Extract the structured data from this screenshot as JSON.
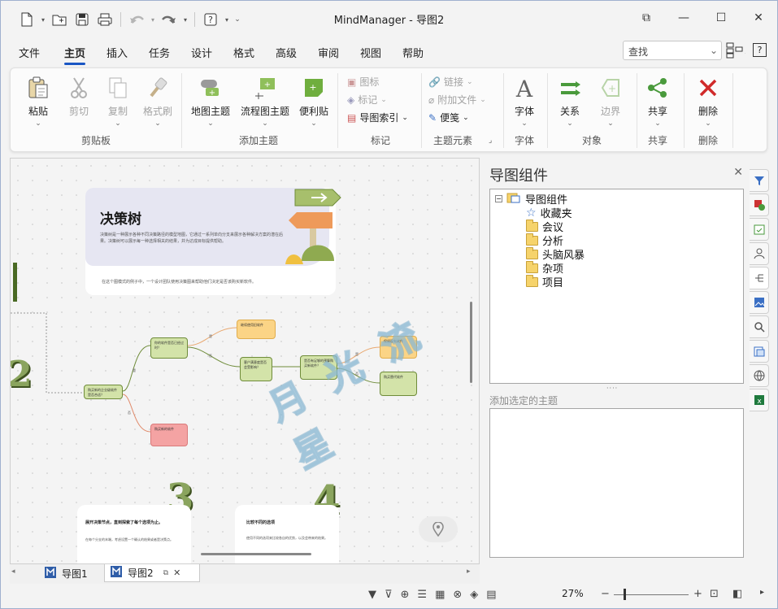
{
  "app": {
    "title": "MindManager - 导图2"
  },
  "menu": {
    "tabs": [
      "文件",
      "主页",
      "插入",
      "任务",
      "设计",
      "格式",
      "高级",
      "审阅",
      "视图",
      "帮助"
    ],
    "active": "主页",
    "search_placeholder": "查找"
  },
  "ribbon": {
    "clipboard": {
      "paste": "粘贴",
      "cut": "剪切",
      "copy": "复制",
      "format_painter": "格式刷",
      "label": "剪贴板"
    },
    "add_topic": {
      "map_topic": "地图主题",
      "flow_topic": "流程图主题",
      "sticky": "便利贴",
      "label": "添加主题"
    },
    "markers": {
      "icon": "图标",
      "tag": "标记",
      "index": "导图索引",
      "label": "标记"
    },
    "elements": {
      "link": "链接",
      "attach": "附加文件",
      "note": "便笺",
      "label": "主题元素"
    },
    "font": {
      "font": "字体",
      "label": "字体"
    },
    "objects": {
      "relation": "关系",
      "boundary": "边界",
      "label": "对象"
    },
    "share": {
      "share": "共享",
      "label": "共享"
    },
    "delete": {
      "delete": "删除",
      "label": "删除"
    }
  },
  "canvas": {
    "card_title": "决策树",
    "card_desc": "决策树是一种展示各种不同决策路径的模型地图，它通过一系列单向分支来展示各种解决方案的潜在后果。决策树可以展示每一种选择相关的结果，并为达成目标提供帮助。",
    "card_footer": "在这个图模式的例子中，一个设计团队使用决策图来帮助他们决定是否该购买新软件。",
    "topics": {
      "root": "购买新的企业级软件是否合适？",
      "t1": "你的软件是否已经过时？",
      "t2": "客户满意度是否会受影响？",
      "t3": "是否有足够的预算购买新软件？",
      "t4": "公司是否能够承担新的软件？",
      "t5": "继续使用旧软件",
      "t6": "购买新的软件",
      "t7": "保留现有软件",
      "t8": "购买替代软件"
    },
    "edge_labels": {
      "yes": "是",
      "no": "否"
    },
    "num3": "3",
    "num4": "4",
    "num2": "2",
    "step3_title": "展开决策节点，直到探索了每个选项为止。",
    "step3_text": "在每个分支的末端，考虑设置一个确认的结果或者是决策点。",
    "step4_title": "比较不同的选项",
    "step4_text": "使用不同的选项来比较各自的优势，以及会带来的结果。",
    "watermark": "月 光 流 星"
  },
  "doc_tabs": [
    {
      "label": "导图1"
    },
    {
      "label": "导图2"
    }
  ],
  "pane": {
    "title": "导图组件",
    "tree": {
      "root": "导图组件",
      "items": [
        "收藏夹",
        "会议",
        "分析",
        "头脑风暴",
        "杂项",
        "项目"
      ]
    },
    "add_label": "添加选定的主题"
  },
  "status": {
    "zoom": "27%"
  }
}
